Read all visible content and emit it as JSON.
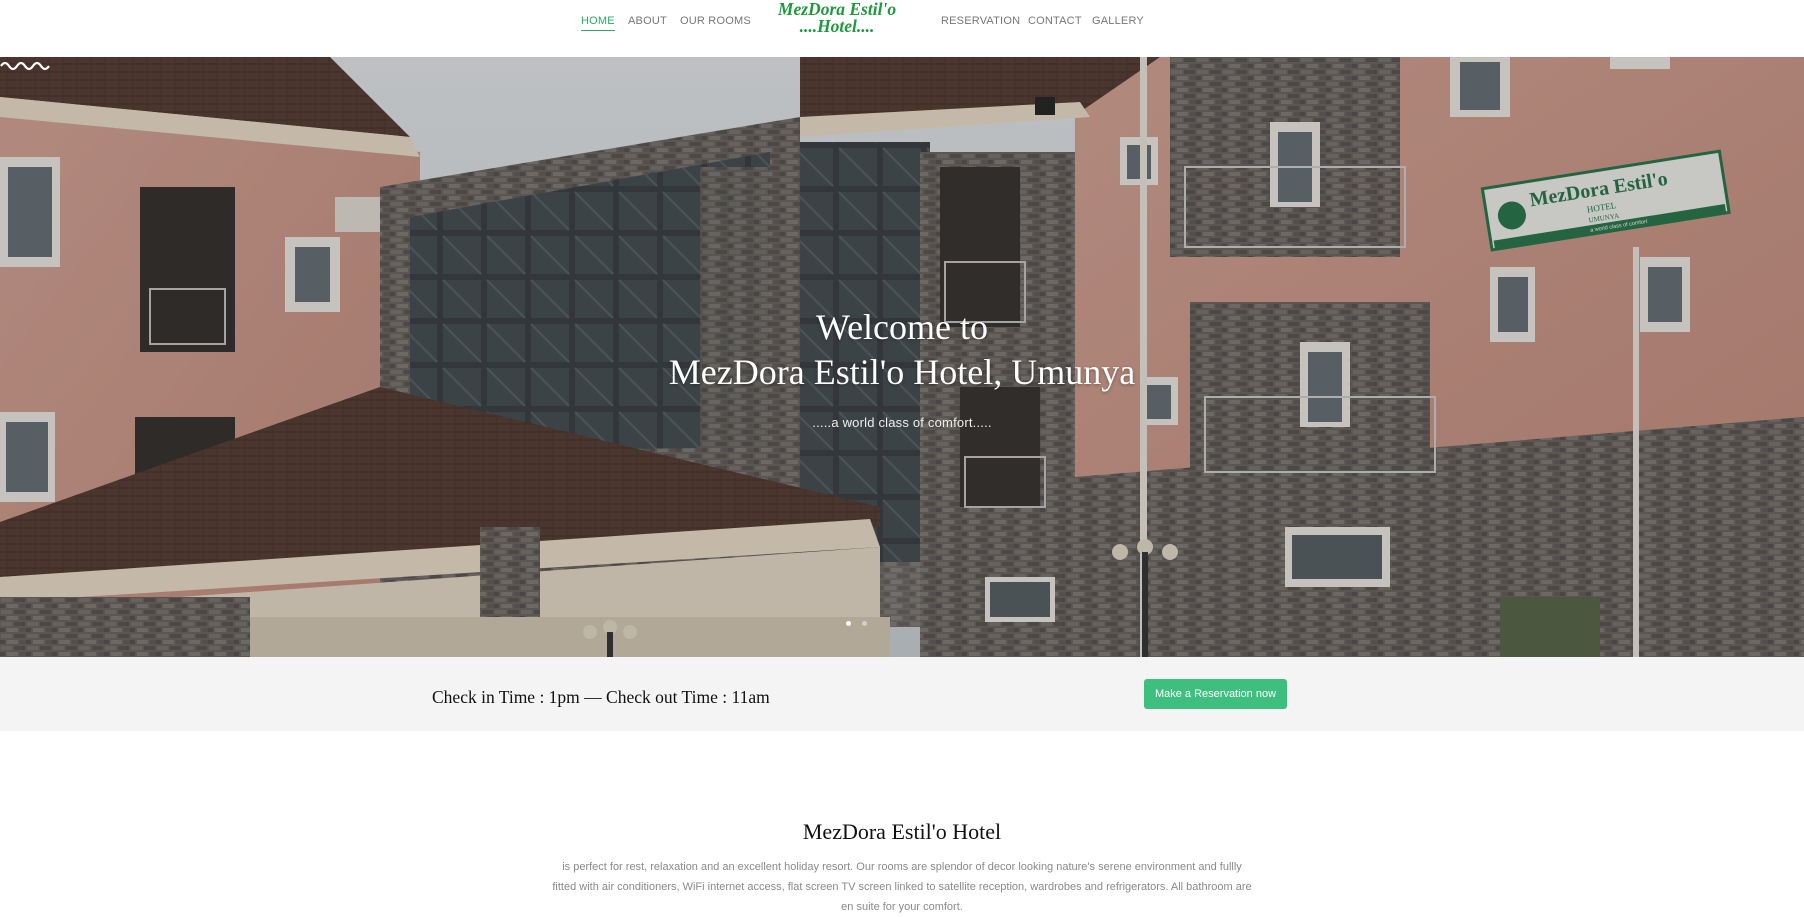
{
  "nav": {
    "left_links": [
      "HOME",
      "ABOUT",
      "OUR ROOMS"
    ],
    "right_links": [
      "RESERVATION",
      "CONTACT",
      "GALLERY"
    ],
    "active": "HOME",
    "brand_line1": "MezDora Estil'o",
    "brand_line2": "....Hotel...."
  },
  "hero": {
    "title_line1": "Welcome to",
    "title_line2": "MezDora Estil'o Hotel, Umunya",
    "subtitle": ".....a world class of comfort.....",
    "sign_line1": "MezDora Estil'o",
    "sign_line2": "HOTEL",
    "sign_line3": "UMUNYA",
    "sign_tagline": "a world class of comfort",
    "slides": 2,
    "active_slide": 1
  },
  "checkin": {
    "text": "Check in Time : 1pm — Check out Time : 11am",
    "button": "Make a Reservation now"
  },
  "about": {
    "title": "MezDora Estil'o Hotel",
    "text": "is perfect for rest, relaxation and an excellent holiday resort. Our rooms are splendor of decor looking nature's serene environment and fullly fitted with air conditioners, WiFi internet access, flat screen TV screen linked to satellite reception, wardrobes and refrigerators. All bathroom are en suite for your comfort."
  },
  "colors": {
    "accent": "#3fbf7f",
    "brand": "#1e9a3e",
    "nav_text": "#777777",
    "strip_bg": "#f4f4f4"
  }
}
